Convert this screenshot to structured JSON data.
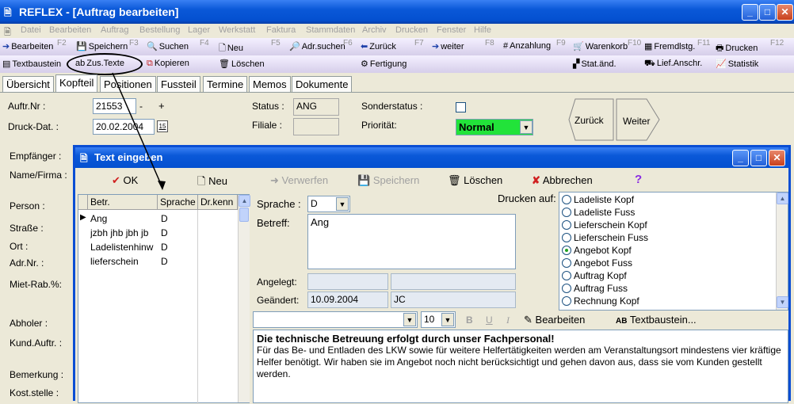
{
  "window": {
    "title": "REFLEX - [Auftrag bearbeiten]"
  },
  "menu": [
    "Datei",
    "Bearbeiten",
    "Auftrag",
    "Bestellung",
    "Lager",
    "Werkstatt",
    "Faktura",
    "Stammdaten",
    "Archiv",
    "Drucken",
    "Fenster",
    "Hilfe"
  ],
  "toolbar1": [
    {
      "label": "Bearbeiten",
      "key": "F2",
      "icon": "arrow-right-icon"
    },
    {
      "label": "Speichern",
      "key": "F3",
      "icon": "save-icon"
    },
    {
      "label": "Suchen",
      "key": "F4",
      "icon": "search-icon"
    },
    {
      "label": "Neu",
      "key": "F5",
      "icon": "new-document-icon"
    },
    {
      "label": "Adr.suchen",
      "key": "F6",
      "icon": "address-search-icon"
    },
    {
      "label": "Zurück",
      "key": "F7",
      "icon": "arrow-left-icon"
    },
    {
      "label": "weiter",
      "key": "F8",
      "icon": "arrow-right-icon"
    },
    {
      "label": "Anzahlung",
      "key": "F9",
      "icon": "down-payment-icon"
    },
    {
      "label": "Warenkorb",
      "key": "F10",
      "icon": "cart-icon"
    },
    {
      "label": "Fremdlstg.",
      "key": "F11",
      "icon": "third-party-icon"
    },
    {
      "label": "Drucken",
      "key": "F12",
      "icon": "printer-icon"
    }
  ],
  "toolbar2": [
    {
      "label": "Textbaustein",
      "icon": "text-block-icon"
    },
    {
      "label": "Zus.Texte",
      "icon": "additional-text-icon"
    },
    {
      "label": "Kopieren",
      "icon": "copy-icon"
    },
    {
      "label": "Löschen",
      "icon": "trash-icon"
    },
    {
      "label": "Fertigung",
      "icon": "production-icon"
    },
    {
      "label": "Stat.änd.",
      "icon": "status-change-icon"
    },
    {
      "label": "Lief.Anschr.",
      "icon": "delivery-address-icon"
    },
    {
      "label": "Statistik",
      "icon": "statistics-icon"
    }
  ],
  "tabs": [
    "Übersicht",
    "Kopfteil",
    "Positionen",
    "Fussteil",
    "Termine",
    "Memos",
    "Dokumente"
  ],
  "header": {
    "auftr_nr_label": "Auftr.Nr :",
    "auftr_nr": "21553",
    "minus": "-",
    "plus": "+",
    "druck_dat_label": "Druck-Dat. :",
    "druck_dat": "20.02.2004",
    "cal": "15",
    "status_label": "Status :",
    "status": "ANG",
    "filiale_label": "Filiale :",
    "filiale": "",
    "sonderstatus_label": "Sonderstatus :",
    "prioritaet_label": "Priorität:",
    "prioritaet": "Normal",
    "prioritaet_color": "#22e33a",
    "back_label": "Zurück",
    "forward_label": "Weiter"
  },
  "left_labels": [
    "Empfänger :",
    "Name/Firma :",
    "Person :",
    "Straße :",
    "Ort :",
    "Adr.Nr. :",
    "Miet-Rab.%:",
    "Abholer :",
    "Kund.Auftr. :",
    "Bemerkung :",
    "Kost.stelle :"
  ],
  "dialog": {
    "title": "Text eingeben",
    "toolbar": [
      {
        "label": "OK",
        "icon": "checkmark-icon",
        "enabled": true
      },
      {
        "label": "Neu",
        "icon": "new-document-icon",
        "enabled": true
      },
      {
        "label": "Verwerfen",
        "icon": "discard-icon",
        "enabled": false
      },
      {
        "label": "Speichern",
        "icon": "save-icon",
        "enabled": false
      },
      {
        "label": "Löschen",
        "icon": "trash-icon",
        "enabled": true
      },
      {
        "label": "Abbrechen",
        "icon": "cancel-x-icon",
        "enabled": true
      },
      {
        "label": "?",
        "icon": "help-icon",
        "enabled": true
      }
    ],
    "grid": {
      "columns": [
        "Betr.",
        "Sprache",
        "Dr.kenn"
      ],
      "rows": [
        {
          "betr": "Ang",
          "sprache": "D",
          "drkenn": ""
        },
        {
          "betr": "jzbh jhb jbh jb",
          "sprache": "D",
          "drkenn": ""
        },
        {
          "betr": "Ladelistenhinw",
          "sprache": "D",
          "drkenn": ""
        },
        {
          "betr": "lieferschein",
          "sprache": "D",
          "drkenn": ""
        }
      ]
    },
    "sprache_label": "Sprache :",
    "sprache": "D",
    "betreff_label": "Betreff:",
    "betreff": "Ang",
    "angelegt_label": "Angelegt:",
    "angelegt_date": "",
    "angelegt_user": "",
    "geaendert_label": "Geändert:",
    "geaendert_date": "10.09.2004",
    "geaendert_user": "JC",
    "drucken_auf_label": "Drucken auf:",
    "print_options": [
      {
        "label": "Ladeliste Kopf",
        "checked": false
      },
      {
        "label": "Ladeliste Fuss",
        "checked": false
      },
      {
        "label": "Lieferschein Kopf",
        "checked": false
      },
      {
        "label": "Lieferschein Fuss",
        "checked": false
      },
      {
        "label": "Angebot Kopf",
        "checked": true
      },
      {
        "label": "Angebot Fuss",
        "checked": false
      },
      {
        "label": "Auftrag Kopf",
        "checked": false
      },
      {
        "label": "Auftrag Fuss",
        "checked": false
      },
      {
        "label": "Rechnung Kopf",
        "checked": false
      }
    ],
    "font_name": "",
    "font_size": "10",
    "bold": "B",
    "underline": "U",
    "italic": "I",
    "edit_label": "Bearbeiten",
    "textbaustein_label": "Textbaustein...",
    "text_heading": "Die technische Betreuung erfolgt durch unser Fachpersonal!",
    "text_body": "Für das Be- und Entladen des LKW sowie für weitere Helfertätigkeiten werden am Veranstaltungsort mindestens vier kräftige Helfer benötigt. Wir haben sie im Angebot noch nicht berücksichtigt und gehen davon aus, dass sie vom Kunden gestellt werden."
  }
}
